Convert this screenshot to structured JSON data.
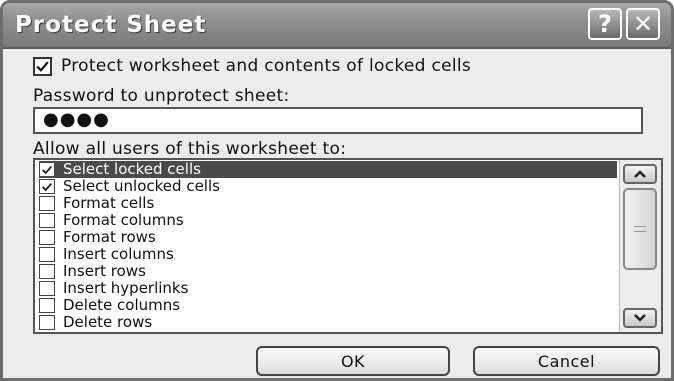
{
  "window": {
    "title": "Protect Sheet",
    "help_glyph": "?",
    "close_glyph": "✕"
  },
  "protect": {
    "label": "Protect worksheet and contents of locked cells",
    "checked": true
  },
  "password": {
    "label": "Password to unprotect sheet:",
    "value": "●●●●"
  },
  "allow": {
    "label": "Allow all users of this worksheet to:",
    "items": [
      {
        "label": "Select locked cells",
        "checked": true,
        "selected": true
      },
      {
        "label": "Select unlocked cells",
        "checked": true,
        "selected": false
      },
      {
        "label": "Format cells",
        "checked": false,
        "selected": false
      },
      {
        "label": "Format columns",
        "checked": false,
        "selected": false
      },
      {
        "label": "Format rows",
        "checked": false,
        "selected": false
      },
      {
        "label": "Insert columns",
        "checked": false,
        "selected": false
      },
      {
        "label": "Insert rows",
        "checked": false,
        "selected": false
      },
      {
        "label": "Insert hyperlinks",
        "checked": false,
        "selected": false
      },
      {
        "label": "Delete columns",
        "checked": false,
        "selected": false
      },
      {
        "label": "Delete rows",
        "checked": false,
        "selected": false
      }
    ]
  },
  "buttons": {
    "ok": "OK",
    "cancel": "Cancel"
  },
  "icons": {
    "help": "question-icon",
    "close": "close-icon",
    "check": "checkmark-icon",
    "scroll_up": "chevron-up-icon",
    "scroll_down": "chevron-down-icon"
  }
}
